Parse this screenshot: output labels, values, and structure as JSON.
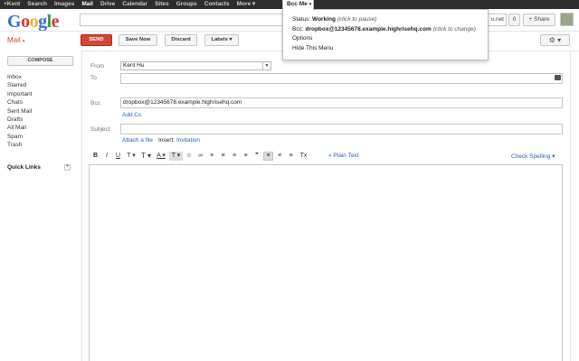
{
  "topbar": {
    "items": [
      "+Kent",
      "Search",
      "Images",
      "Mail",
      "Drive",
      "Calendar",
      "Sites",
      "Groups",
      "Contacts",
      "More"
    ],
    "more_caret": "▾",
    "bcc_me": "Bcc Me",
    "bcc_caret": "▾"
  },
  "header": {
    "logo_letters": [
      "G",
      "o",
      "o",
      "g",
      "l",
      "e"
    ],
    "search_tail": "u.net",
    "count": "0",
    "share": "+ Share"
  },
  "popup": {
    "status_label": "Status:",
    "status_value": "Working",
    "status_hint": "(click to pause)",
    "bcc_label": "Bcc:",
    "bcc_value": "dropbox@12345678.example.highrisehq.com",
    "bcc_hint": "(click to change)",
    "options": "Options",
    "hide": "Hide This Menu"
  },
  "actions": {
    "mail_label": "Mail",
    "mail_caret": "▾",
    "send": "SEND",
    "save_now": "Save Now",
    "discard": "Discard",
    "labels": "Labels",
    "labels_caret": "▾",
    "gear": "⚙ ▾"
  },
  "sidebar": {
    "compose": "COMPOSE",
    "folders": [
      "Inbox",
      "Starred",
      "Important",
      "Chats",
      "Sent Mail",
      "Drafts",
      "All Mail",
      "Spam",
      "Trash"
    ],
    "quick_links": "Quick Links",
    "quick_add": "+"
  },
  "compose_form": {
    "from_label": "From",
    "from_value": "Kent Hu",
    "to_label": "To",
    "bcc_label": "Bcc",
    "bcc_value": "dropbox@12345678.example.highrisehq.com",
    "add_cc": "Add Cc",
    "subject_label": "Subject",
    "attach": "Attach a file",
    "insert": "Insert:",
    "invitation": "Invitation"
  },
  "toolbar": {
    "buttons": [
      "B",
      "I",
      "U",
      "T ▾",
      "T ▾",
      "A ▾",
      "T ▾",
      "☺",
      "∞",
      "≡",
      "≡",
      "≡",
      "≡",
      "❞",
      "≡",
      "≡",
      "≡",
      "Tx"
    ],
    "plain_text": "« Plain Text",
    "check_spelling": "Check Spelling ▾"
  }
}
